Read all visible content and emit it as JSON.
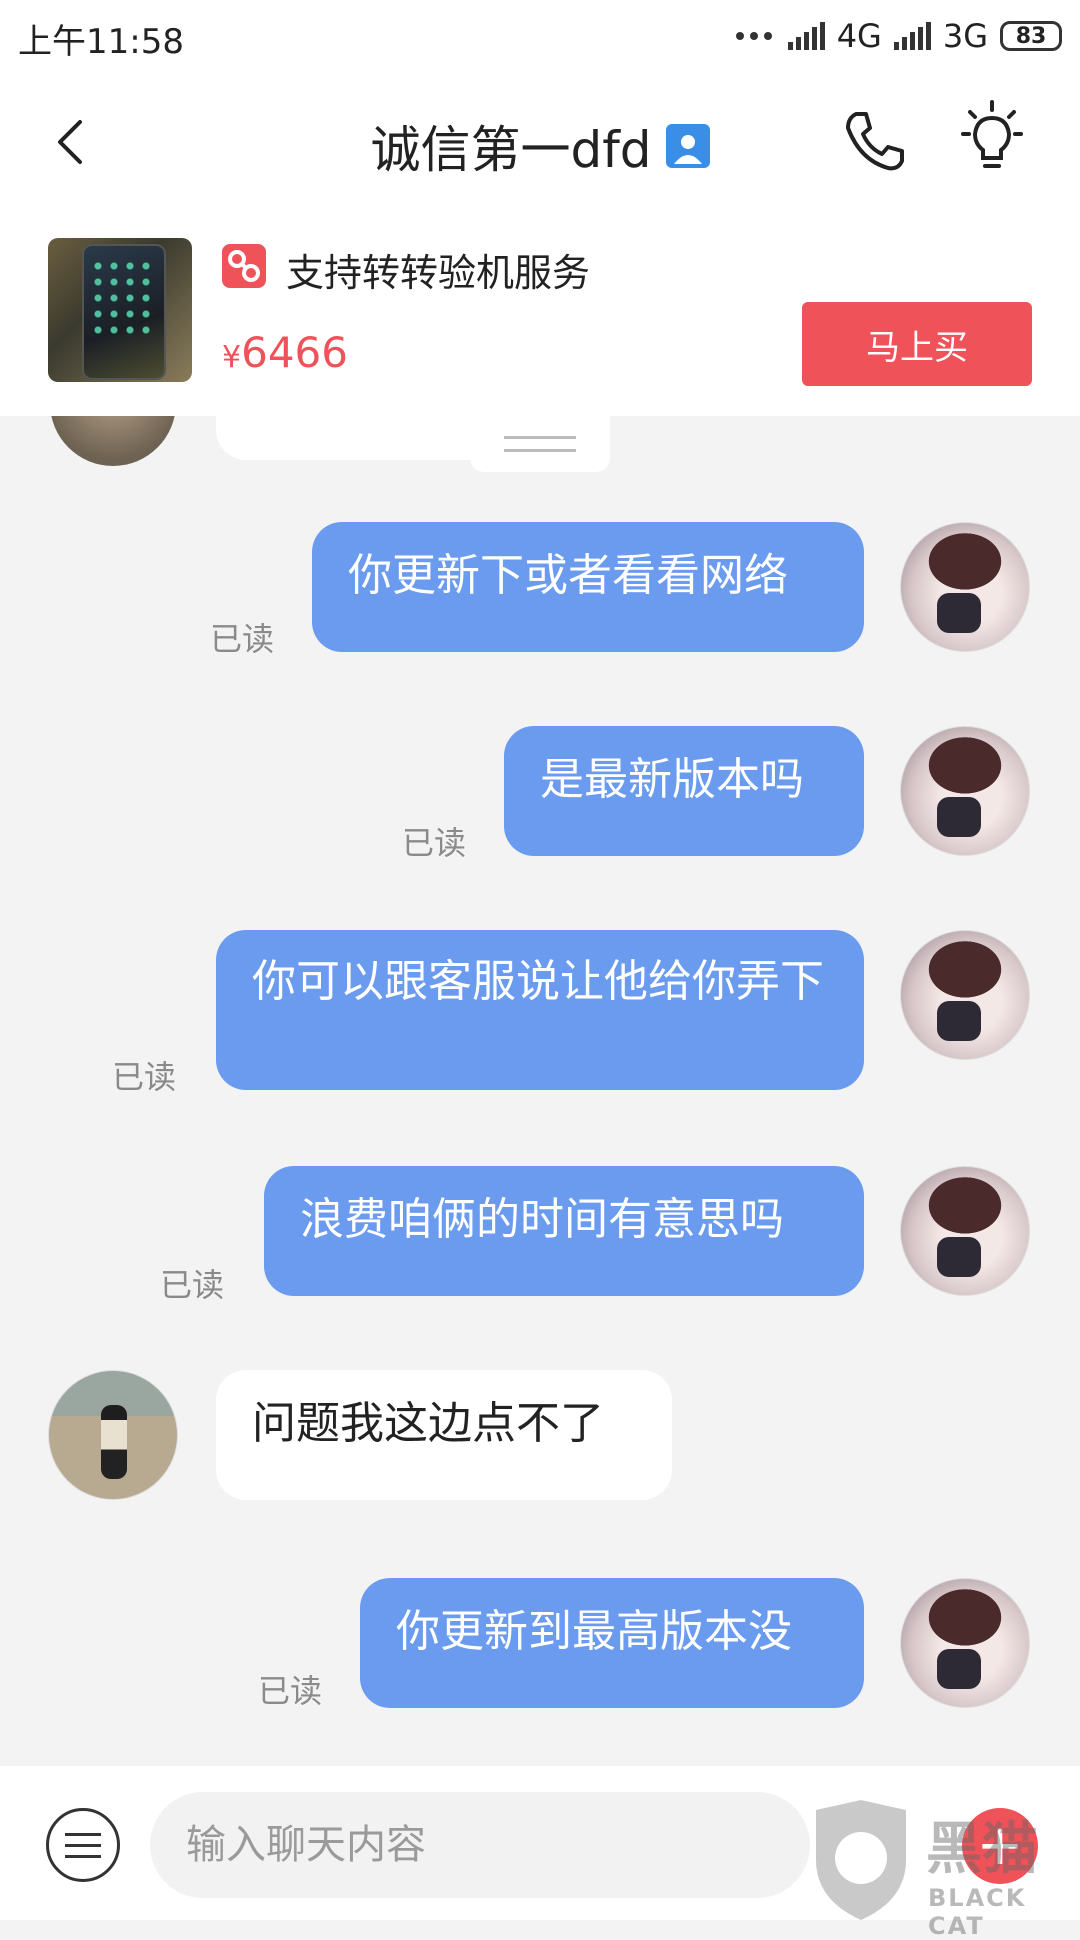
{
  "status_bar": {
    "time": "上午11:58",
    "network_1": "4G",
    "network_2": "3G",
    "battery": "83"
  },
  "header": {
    "title": "诚信第一dfd"
  },
  "product": {
    "service_label": "支持转转验机服务",
    "currency": "¥",
    "price": "6466",
    "buy_label": "马上买"
  },
  "messages": [
    {
      "side": "out",
      "text": "你更新下或者看看网络",
      "status": "已读"
    },
    {
      "side": "out",
      "text": "是最新版本吗",
      "status": "已读"
    },
    {
      "side": "out",
      "text": "你可以跟客服说让他给你弄下",
      "status": "已读"
    },
    {
      "side": "out",
      "text": "浪费咱俩的时间有意思吗",
      "status": "已读"
    },
    {
      "side": "in",
      "text": "问题我这边点不了"
    },
    {
      "side": "out",
      "text": "你更新到最高版本没",
      "status": "已读"
    }
  ],
  "input": {
    "placeholder": "输入聊天内容"
  },
  "watermark": {
    "logo_text": "黑猫",
    "sub_text": "BLACK CAT"
  },
  "colors": {
    "accent": "#f0525a",
    "bubble_out": "#6b9bef",
    "background": "#f3f3f3"
  }
}
